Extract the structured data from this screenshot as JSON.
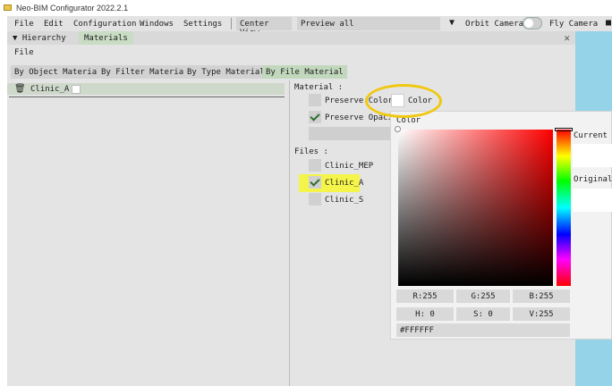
{
  "app": {
    "title": "Neo-BIM Configurator 2022.2.1"
  },
  "menubar": {
    "items": [
      "File",
      "Edit",
      "Configuration",
      "Windows",
      "Settings"
    ],
    "center_view": "Center View",
    "preview_all": "Preview all",
    "camera_dropdown": "Orbit Camera",
    "fly_camera": "Fly Camera"
  },
  "panel": {
    "tabs": [
      "Hierarchy",
      "Materials"
    ],
    "file_label": "File",
    "subtabs": [
      "By Object Material",
      "By Filter Material",
      "By Type Material",
      "By File Material"
    ],
    "material_item": "Clinic_A",
    "material_header": "Material :",
    "preserve_color": "Preserve Color",
    "color_button": "Color",
    "preserve_opacity": "Preserve Opacity",
    "files_header": "Files :",
    "files": [
      {
        "name": "Clinic_MEP",
        "checked": false
      },
      {
        "name": "Clinic_A",
        "checked": true
      },
      {
        "name": "Clinic_S",
        "checked": false
      }
    ]
  },
  "color_picker": {
    "title": "Color",
    "current_label": "Current",
    "original_label": "Original",
    "r": "R:255",
    "g": "G:255",
    "b": "B:255",
    "h": "H:  0",
    "s": "S:  0",
    "v": "V:255",
    "hex": "#FFFFFF",
    "current_color": "#ffffff",
    "original_color": "#ffffff"
  },
  "colors": {
    "highlight_circle": "#f0c810",
    "highlight_marker": "#f4f44a",
    "accent_green": "#2e6e2e"
  }
}
